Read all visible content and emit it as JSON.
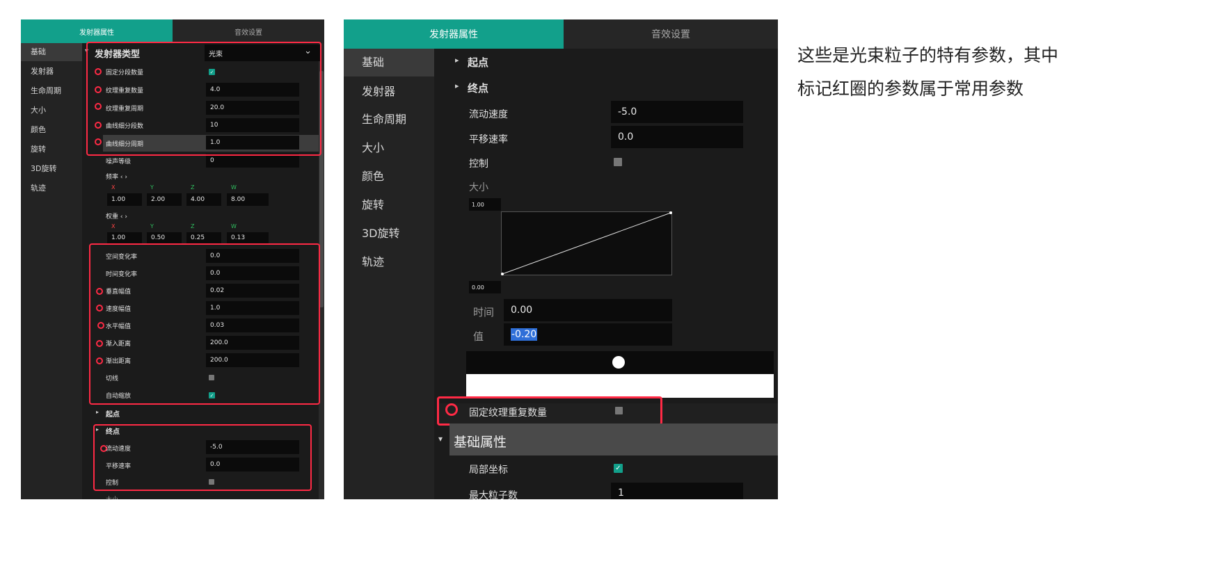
{
  "left": {
    "tabs": [
      "发射器属性",
      "音效设置"
    ],
    "sidebar": [
      "基础",
      "发射器",
      "生命周期",
      "大小",
      "颜色",
      "旋转",
      "3D旋转",
      "轨迹"
    ],
    "emitter_type_label": "发射器类型",
    "emitter_type_value": "光束",
    "rows_a": [
      {
        "label": "固定分段数量",
        "checked": true
      },
      {
        "label": "纹理重复数量",
        "value": "4.0"
      },
      {
        "label": "纹理重复周期",
        "value": "20.0"
      },
      {
        "label": "曲线细分段数",
        "value": "10"
      },
      {
        "label": "曲线细分周期",
        "value": "1.0"
      },
      {
        "label": "噪声等级",
        "value": "0"
      }
    ],
    "freq_label": "频率 ‹ ›",
    "freq_axes": [
      "X",
      "Y",
      "Z",
      "W"
    ],
    "freq_values": [
      "1.00",
      "2.00",
      "4.00",
      "8.00"
    ],
    "weight_label": "权重 ‹ ›",
    "weight_axes": [
      "X",
      "Y",
      "Z",
      "W"
    ],
    "weight_values": [
      "1.00",
      "0.50",
      "0.25",
      "0.13"
    ],
    "rows_b": [
      {
        "label": "空间变化率",
        "value": "0.0"
      },
      {
        "label": "时间变化率",
        "value": "0.0"
      },
      {
        "label": "垂直幅值",
        "value": "0.02"
      },
      {
        "label": "速度幅值",
        "value": "1.0"
      },
      {
        "label": "水平幅值",
        "value": "0.03"
      },
      {
        "label": "渐入距离",
        "value": "200.0"
      },
      {
        "label": "渐出距离",
        "value": "200.0"
      },
      {
        "label": "切线"
      },
      {
        "label": "自动缩放",
        "checked": true
      }
    ],
    "start_label": "起点",
    "end_label": "终点",
    "rows_c": [
      {
        "label": "流动速度",
        "value": "-5.0"
      },
      {
        "label": "平移速率",
        "value": "0.0"
      },
      {
        "label": "控制"
      }
    ],
    "cut_label": "大小"
  },
  "right": {
    "tabs": [
      "发射器属性",
      "音效设置"
    ],
    "sidebar": [
      "基础",
      "发射器",
      "生命周期",
      "大小",
      "颜色",
      "旋转",
      "3D旋转",
      "轨迹"
    ],
    "start_label": "起点",
    "end_label": "终点",
    "rows": [
      {
        "label": "流动速度",
        "value": "-5.0"
      },
      {
        "label": "平移速率",
        "value": "0.0"
      },
      {
        "label": "控制"
      }
    ],
    "size_label": "大小",
    "curve_top": "1.00",
    "curve_bottom": "0.00",
    "time_label": "时间",
    "time_value": "0.00",
    "value_label": "值",
    "value_value": "-0.20",
    "fixed_repeat_label": "固定纹理重复数量",
    "section_label": "基础属性",
    "local_coord_label": "局部坐标",
    "max_particles_label": "最大粒子数",
    "max_particles_value": "1"
  },
  "note": [
    "这些是光束粒子的特有参数，其中",
    "标记红圈的参数属于常用参数"
  ],
  "colors": {
    "accent": "#12a08b",
    "marker": "#ff2a45",
    "panel": "#1b1b1b"
  }
}
